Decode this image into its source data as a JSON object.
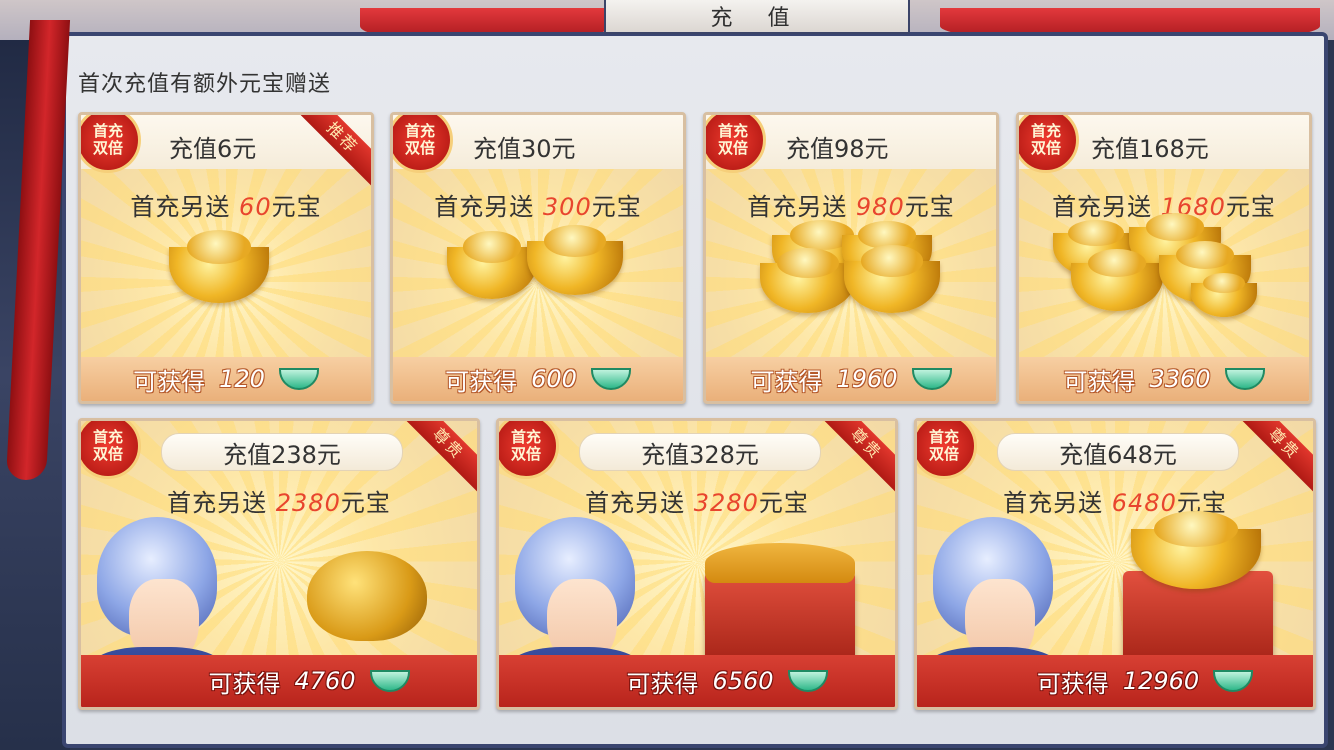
{
  "window": {
    "title": "充 值"
  },
  "notice": "首次充值有额外元宝赠送",
  "badge": {
    "line1": "首充",
    "line2": "双倍"
  },
  "gain_label": "可获得",
  "bonus_prefix": "首充另送",
  "bonus_suffix": "元宝",
  "packs": [
    {
      "price": "充值6元",
      "bonus": "60",
      "gain": "120",
      "tag": "推荐"
    },
    {
      "price": "充值30元",
      "bonus": "300",
      "gain": "600",
      "tag": ""
    },
    {
      "price": "充值98元",
      "bonus": "980",
      "gain": "1960",
      "tag": ""
    },
    {
      "price": "充值168元",
      "bonus": "1680",
      "gain": "3360",
      "tag": ""
    },
    {
      "price": "充值238元",
      "bonus": "2380",
      "gain": "4760",
      "tag": "尊贵"
    },
    {
      "price": "充值328元",
      "bonus": "3280",
      "gain": "6560",
      "tag": "尊贵"
    },
    {
      "price": "充值648元",
      "bonus": "6480",
      "gain": "12960",
      "tag": "尊贵"
    }
  ],
  "colors": {
    "bonus_amount": "#e8452e",
    "panel_border": "#3a4570",
    "ribbon": "#c82820"
  }
}
